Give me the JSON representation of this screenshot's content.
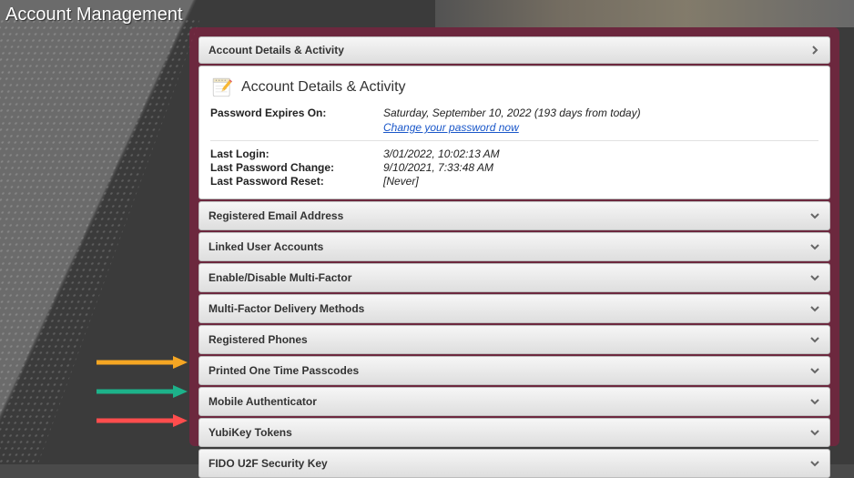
{
  "page": {
    "title": "Account Management"
  },
  "accordion": {
    "expanded": {
      "header": "Account Details & Activity",
      "body_title": "Account Details & Activity",
      "rows": {
        "pw_expires_label": "Password Expires On:",
        "pw_expires_value": "Saturday, September 10, 2022 (193 days from today)",
        "change_pw_link": "Change your password now",
        "last_login_label": "Last Login:",
        "last_login_value": "3/01/2022, 10:02:13 AM",
        "last_pw_change_label": "Last Password Change:",
        "last_pw_change_value": "9/10/2021, 7:33:48 AM",
        "last_pw_reset_label": "Last Password Reset:",
        "last_pw_reset_value": "[Never]"
      }
    },
    "collapsed": [
      "Registered Email Address",
      "Linked User Accounts",
      "Enable/Disable Multi-Factor",
      "Multi-Factor Delivery Methods",
      "Registered Phones",
      "Printed One Time Passcodes",
      "Mobile Authenticator",
      "YubiKey Tokens",
      "FIDO U2F Security Key"
    ]
  },
  "arrows": {
    "orange": "#f5a623",
    "teal": "#1db28a",
    "red": "#ff4d4d"
  }
}
